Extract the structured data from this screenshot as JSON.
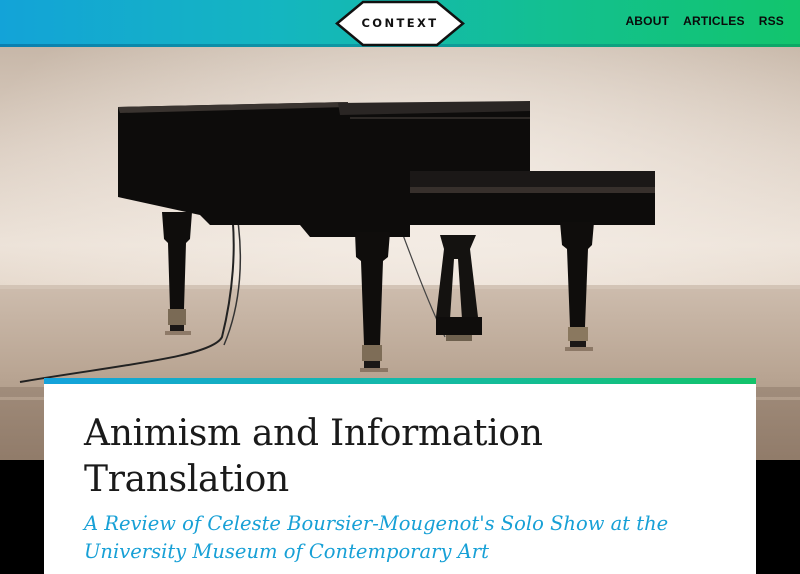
{
  "header": {
    "logo_text": "CONTEXT",
    "nav": [
      "ABOUT",
      "ARTICLES",
      "RSS"
    ]
  },
  "hero": {
    "image_subject": "grand-piano"
  },
  "article": {
    "title": "Animism and Information Translation",
    "subtitle": "A Review of Celeste Boursier-Mougenot's Solo Show at the University Museum of Contemporary Art"
  },
  "colors": {
    "accent_blue": "#17a0d6",
    "accent_green": "#12c56d",
    "title_text": "#1a1a1a"
  }
}
